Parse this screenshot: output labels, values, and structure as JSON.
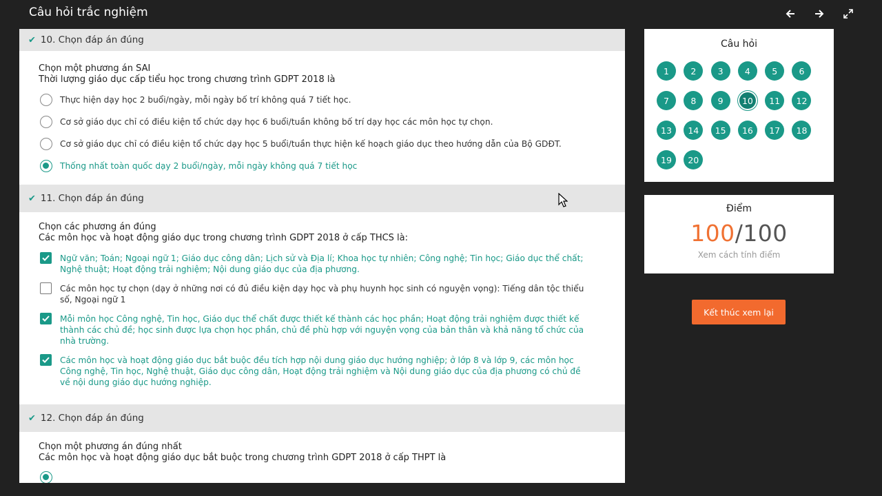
{
  "app": {
    "title": "Câu hỏi trắc nghiệm"
  },
  "toolbar": {
    "icons": [
      "arrow-left-icon",
      "arrow-right-icon",
      "expand-icon"
    ]
  },
  "questions": [
    {
      "header": "10. Chọn đáp án đúng",
      "prompt1": "Chọn một phương án SAI",
      "prompt2": "Thời lượng giáo dục cấp tiểu học trong chương trình GDPT 2018 là",
      "type": "radio",
      "options": [
        {
          "text": "Thực hiện dạy học 2 buổi/ngày, mỗi ngày bố trí không quá 7 tiết học.",
          "selected": false
        },
        {
          "text": "Cơ sở giáo dục chỉ có điều kiện tổ chức dạy học 6 buổi/tuần không bố trí dạy học các môn học tự chọn.",
          "selected": false
        },
        {
          "text": "Cơ sở giáo dục chỉ có điều kiện tổ chức dạy học 5 buổi/tuần thực hiện kế hoạch giáo dục theo hướng dẫn của Bộ GDĐT.",
          "selected": false
        },
        {
          "text": "Thống nhất toàn quốc dạy 2 buổi/ngày, mỗi ngày không quá 7 tiết học",
          "selected": true
        }
      ]
    },
    {
      "header": "11. Chọn đáp án đúng",
      "prompt1": "Chọn các phương án đúng",
      "prompt2": "Các môn học và hoạt động giáo dục trong chương trình GDPT 2018 ở cấp THCS là:",
      "type": "checkbox",
      "options": [
        {
          "line1": "Ngữ văn; Toán; Ngoại ngữ 1; Giáo dục công dân; Lịch sử và Địa lí; Khoa học tự nhiên; Công nghệ; Tin học; Giáo dục thể chất;",
          "line2": "Nghệ thuật; Hoạt động trải nghiệm; Nội dung giáo dục của địa phương.",
          "line3": "",
          "checked": true
        },
        {
          "line1": "Các môn học tự chọn (dạy ở những nơi có đủ điều kiện dạy học và phụ huynh học sinh có nguyện vọng): Tiếng dân tộc thiểu",
          "line2": "số, Ngoại ngữ 1",
          "line3": "",
          "checked": false
        },
        {
          "line1": "Mỗi môn học Công nghệ, Tin học, Giáo dục thể chất được thiết kế thành các học phần; Hoạt động trải nghiệm được thiết kế",
          "line2": "thành các chủ đề; học sinh được lựa chọn học phần, chủ đề phù hợp với nguyện vọng của bản thân và khả năng tổ chức của",
          "line3": "nhà trường.",
          "checked": true
        },
        {
          "line1": "Các môn học và hoạt động giáo dục bắt buộc đều tích hợp nội dung giáo dục hướng nghiệp; ở lớp 8 và lớp 9, các môn học",
          "line2": "Công nghệ, Tin học, Nghệ thuật, Giáo dục công dân, Hoạt động trải nghiệm và Nội dung giáo dục của địa phương có chủ đề",
          "line3": "về nội dung giáo dục hướng nghiệp.",
          "checked": true
        }
      ]
    },
    {
      "header": "12. Chọn đáp án đúng",
      "prompt1": "Chọn một  phương án đúng nhất",
      "prompt2": "Các môn học và hoạt động giáo dục bắt buộc trong chương trình GDPT 2018 ở cấp THPT là"
    }
  ],
  "navigator": {
    "title": "Câu hỏi",
    "numbers": [
      "1",
      "2",
      "3",
      "4",
      "5",
      "6",
      "7",
      "8",
      "9",
      "10",
      "11",
      "12",
      "13",
      "14",
      "15",
      "16",
      "17",
      "18",
      "19",
      "20"
    ],
    "current": "10"
  },
  "score": {
    "title": "Điểm",
    "got": "100",
    "separator": "/",
    "total": "100",
    "link": "Xem cách tính điểm"
  },
  "finish_button": "Kết thúc xem lại",
  "colors": {
    "accent": "#1a9988",
    "orange": "#f26a2e",
    "background": "#212121"
  }
}
